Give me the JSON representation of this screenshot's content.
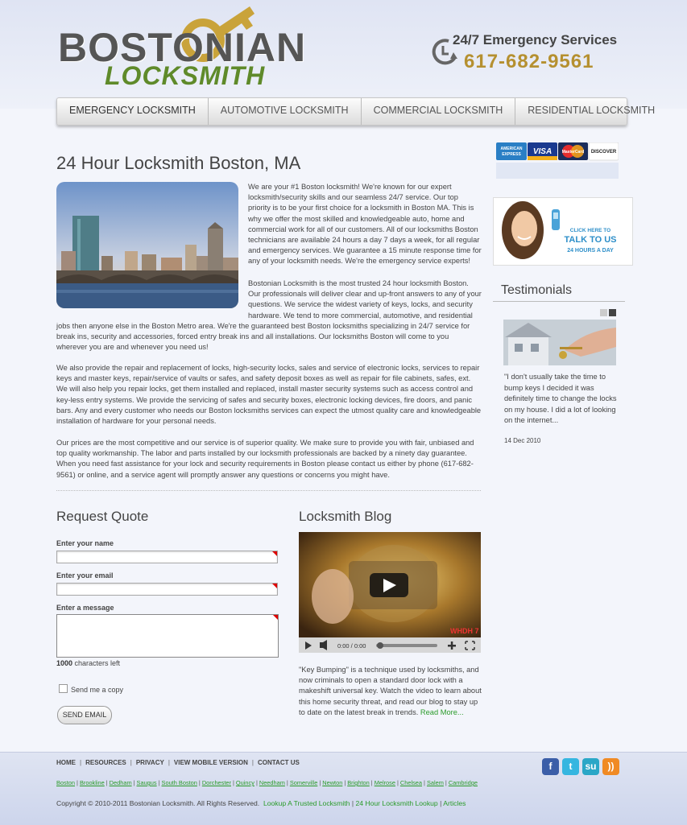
{
  "header": {
    "logo_word1": "BOSTONIAN",
    "logo_word2": "LOCKSMITH",
    "emergency_label": "24/7 Emergency Services",
    "phone": "617-682-9561"
  },
  "nav": [
    "EMERGENCY LOCKSMITH",
    "AUTOMOTIVE LOCKSMITH",
    "COMMERCIAL LOCKSMITH",
    "RESIDENTIAL LOCKSMITH"
  ],
  "main": {
    "title": "24 Hour Locksmith Boston, MA",
    "p1": "We are your #1 Boston locksmith! We're known for our expert locksmith/security skills and our seamless 24/7 service. Our top priority is to be your first choice for a locksmith in Boston MA. This is why we offer the most skilled and knowledgeable auto, home and commercial work for all of our customers. All of our locksmiths Boston technicians are available 24 hours a day 7 days a week, for all regular and emergency services. We guarantee a 15 minute response time for any of your locksmith needs. We're the emergency service experts!",
    "p2a": "Bostonian Locksmith is the most trusted 24 hour locksmith Boston. Our professionals will deliver clear and up-front answers to any of your questions. We service the widest variety of keys, locks, and security hardware. We tend to more commercial, automotive, and residential",
    "p2b": "jobs then anyone else in the Boston Metro area. We're the guaranteed best Boston locksmiths specializing in 24/7 service for break ins, security and accessories, forced entry break ins and all installations. Our locksmiths Boston will come to you wherever you are and whenever you need us!",
    "p3": "We also provide the repair and replacement of locks, high-security locks, sales and service of electronic locks, services to repair keys and master keys, repair/service of vaults or safes, and safety deposit boxes as well as repair for file cabinets, safes, ext. We will also help you repair locks, get them installed and replaced, install master security systems such as access control and key-less entry systems. We provide the servicing of safes and security boxes, electronic locking devices, fire doors, and panic bars. Any and every customer who needs our Boston locksmiths services can expect the utmost quality care and knowledgeable installation of hardware for your personal needs.",
    "p4": "Our prices are the most competitive and our service is of superior quality. We make sure to provide you with fair, unbiased and top quality workmanship. The labor and parts installed by our locksmith professionals are backed by a ninety day guarantee. When you need fast assistance for your lock and security requirements in Boston please contact us either by phone (617-682-9561) or online, and a service agent will promptly answer any questions or concerns you might have."
  },
  "quote_form": {
    "title": "Request Quote",
    "name_label": "Enter your name",
    "email_label": "Enter your email",
    "message_label": "Enter a message",
    "chars_count": "1000",
    "chars_suffix": " characters left",
    "copy_label": "Send me a copy",
    "send_button": "SEND EMAIL"
  },
  "blog": {
    "title": "Locksmith Blog",
    "video_time": "0:00 / 0:00",
    "video_brand": "WHDH 7 HeyTube",
    "text": "\"Key Bumping\" is a technique used by locksmiths, and now criminals to open a standard door lock with a makeshift universal key. Watch the video to learn about this home security threat, and read our blog to stay up to date on the latest break in trends.",
    "read_more": "Read More..."
  },
  "sidebar": {
    "cards": [
      "AMERICAN EXPRESS",
      "VISA",
      "MasterCard",
      "DISCOVER"
    ],
    "talk_line1": "CLICK HERE TO",
    "talk_line2": "TALK TO US",
    "talk_line3": "24 HOURS A DAY",
    "testimonials_title": "Testimonials",
    "quote": "\"I don't usually take the time to bump keys I decided it was definitely time to change the locks on my house. I did a lot of looking on the internet...",
    "quote_date": "14 Dec 2010"
  },
  "footer": {
    "nav": [
      "HOME",
      "RESOURCES",
      "PRIVACY",
      "VIEW MOBILE VERSION",
      "CONTACT US"
    ],
    "cities": [
      "Boston",
      "Brookline",
      "Dedham",
      "Saugus",
      "South Boston",
      "Dorchester",
      "Quincy",
      "Needham",
      "Somerville",
      "Newton",
      "Brighton",
      "Melrose",
      "Chelsea",
      "Salem",
      "Cambridge"
    ],
    "copyright": "Copyright © 2010-2011 Bostonian Locksmith. All Rights Reserved.",
    "links": [
      "Lookup A Trusted Locksmith",
      "24 Hour Locksmith Lookup",
      "Articles"
    ],
    "social": [
      {
        "icon": "facebook-icon",
        "glyph": "f",
        "color": "#3b5ea8"
      },
      {
        "icon": "twitter-icon",
        "glyph": "t",
        "color": "#35b6e0"
      },
      {
        "icon": "stumbleupon-icon",
        "glyph": "su",
        "color": "#2aa7c7"
      },
      {
        "icon": "rss-icon",
        "glyph": "))",
        "color": "#f08a24"
      }
    ]
  }
}
